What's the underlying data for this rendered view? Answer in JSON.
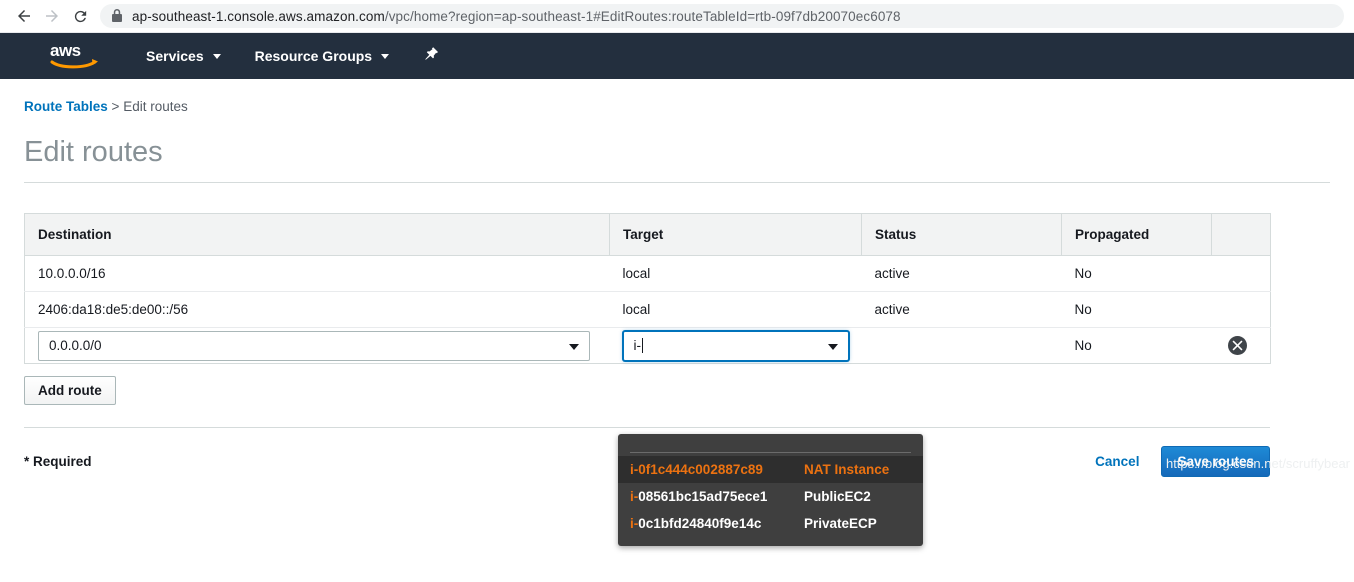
{
  "browser": {
    "back_icon": "back-arrow-icon",
    "forward_icon": "forward-arrow-icon",
    "reload_icon": "reload-icon",
    "lock_icon": "lock-icon",
    "url_main": "ap-southeast-1.console.aws.amazon.com",
    "url_path": "/vpc/home?region=ap-southeast-1#EditRoutes:routeTableId=rtb-09f7db20070ec6078"
  },
  "aws_nav": {
    "logo": "aws-logo",
    "services_label": "Services",
    "resource_groups_label": "Resource Groups",
    "pin_icon": "pin-icon",
    "bg_color": "#232f3e"
  },
  "breadcrumb": {
    "parent": "Route Tables",
    "separator": ">",
    "current": "Edit routes"
  },
  "page": {
    "title": "Edit routes",
    "required_note": "* Required"
  },
  "table": {
    "headers": [
      "Destination",
      "Target",
      "Status",
      "Propagated",
      ""
    ],
    "rows": [
      {
        "destination": "10.0.0.0/16",
        "target": "local",
        "status": "active",
        "propagated": "No"
      },
      {
        "destination": "2406:da18:de5:de00::/56",
        "target": "local",
        "status": "active",
        "propagated": "No"
      }
    ],
    "edit_row": {
      "destination_value": "0.0.0.0/0",
      "target_value": "i-",
      "propagated": "No",
      "remove_icon": "remove-circle-icon"
    },
    "status_color": "#1d8102"
  },
  "autocomplete": {
    "accent_color": "#ec7211",
    "bg_color": "#3f3f3f",
    "options": [
      {
        "id_prefix": "i-",
        "id_rest": "0f1c444c002887c89",
        "name": "NAT Instance",
        "selected": true
      },
      {
        "id_prefix": "i-",
        "id_rest": "08561bc15ad75ece1",
        "name": "PublicEC2",
        "selected": false
      },
      {
        "id_prefix": "i-",
        "id_rest": "0c1bfd24840f9e14c",
        "name": "PrivateECP",
        "selected": false
      }
    ]
  },
  "buttons": {
    "add_route": "Add route",
    "cancel": "Cancel",
    "save_routes": "Save routes"
  },
  "watermark": "https://blog.csdn.net/scruffybear"
}
